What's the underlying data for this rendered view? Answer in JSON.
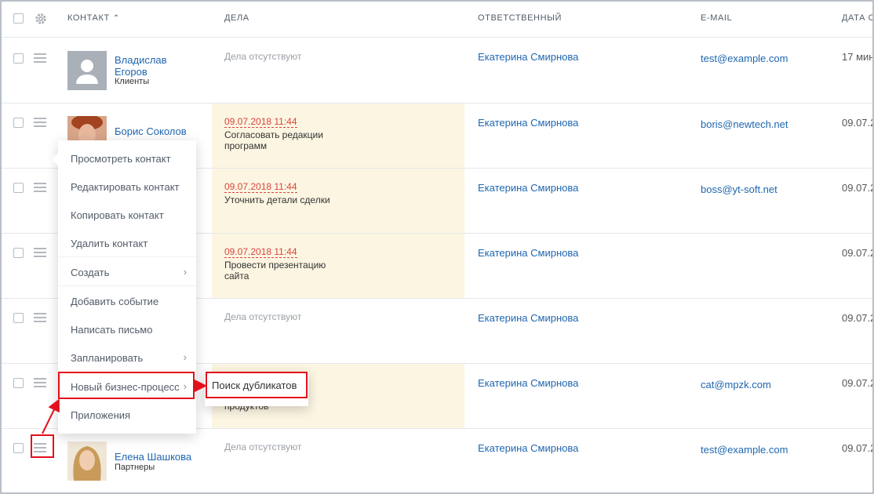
{
  "header": {
    "contact": "КОНТАКТ",
    "sort_icon": "chevron-up-icon",
    "deals": "ДЕЛА",
    "responsible": "ОТВЕТСТВЕННЫЙ",
    "email": "E-MAIL",
    "date": "ДАТА С"
  },
  "rows": [
    {
      "name": "Владислав Егоров",
      "type": "Клиенты",
      "no_deals": "Дела отсутствуют",
      "responsible": "Екатерина Смирнова",
      "email": "test@example.com",
      "date": "17 мин"
    },
    {
      "name": "Борис Соколов",
      "deal_date": "09.07.2018 11:44",
      "deal_text": "Согласовать редакции программ",
      "responsible": "Екатерина Смирнова",
      "email": "boris@newtech.net",
      "date": "09.07.2"
    },
    {
      "deal_date": "09.07.2018 11:44",
      "deal_text": "Уточнить детали сделки",
      "responsible": "Екатерина Смирнова",
      "email": "boss@yt-soft.net",
      "date": "09.07.2"
    },
    {
      "deal_date": "09.07.2018 11:44",
      "deal_text": "Провести презентацию сайта",
      "responsible": "Екатерина Смирнова",
      "date": "09.07.2"
    },
    {
      "no_deals": "Дела отсутствуют",
      "responsible": "Екатерина Смирнова",
      "date": "09.07.2"
    },
    {
      "deal_text_tail": "продуктов",
      "responsible": "Екатерина Смирнова",
      "email": "cat@mpzk.com",
      "date": "09.07.2"
    },
    {
      "name": "Елена Шашкова",
      "type": "Партнеры",
      "no_deals": "Дела отсутствуют",
      "responsible": "Екатерина Смирнова",
      "email": "test@example.com",
      "date": "09.07.2"
    }
  ],
  "menu": {
    "items": [
      {
        "label": "Просмотреть контакт"
      },
      {
        "label": "Редактировать контакт"
      },
      {
        "label": "Копировать контакт"
      },
      {
        "label": "Удалить контакт"
      },
      {
        "label": "Создать"
      },
      {
        "label": "Добавить событие"
      },
      {
        "label": "Написать письмо"
      },
      {
        "label": "Запланировать"
      },
      {
        "label": "Новый бизнес-процесс"
      },
      {
        "label": "Приложения"
      }
    ],
    "submenu_label": "Поиск дубликатов"
  },
  "colors": {
    "link": "#2067b0",
    "deal_bg": "#fcf5e2",
    "overdue": "#d9453f",
    "highlight": "#e3101c"
  }
}
